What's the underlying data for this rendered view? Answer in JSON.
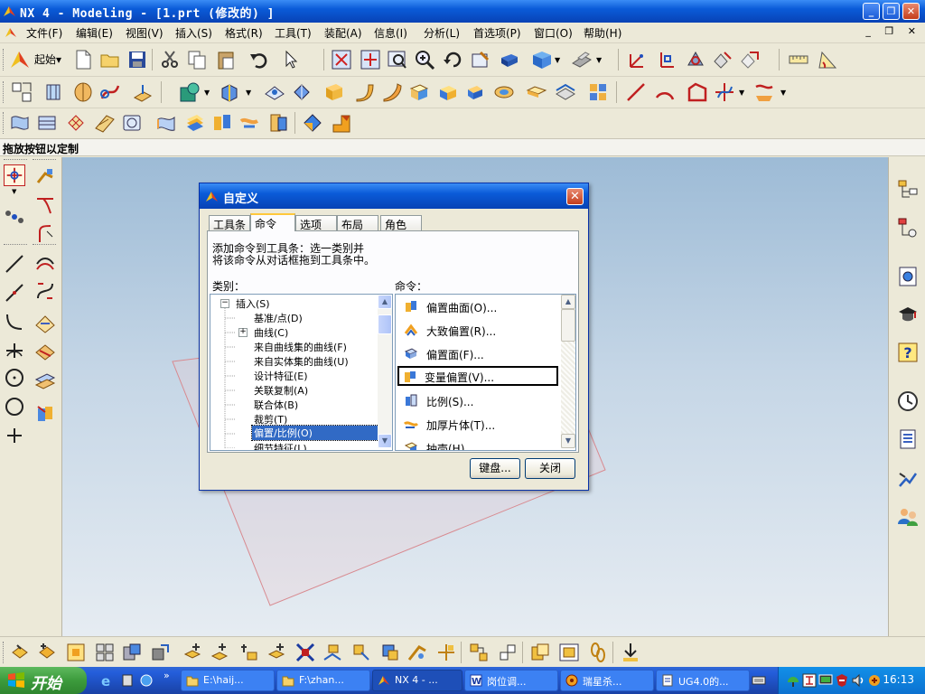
{
  "window": {
    "title": "NX 4 - Modeling - [1.prt (修改的) ]",
    "controls": [
      "_",
      "❐",
      "✕"
    ]
  },
  "menu": {
    "items": [
      "文件(F)",
      "编辑(E)",
      "视图(V)",
      "插入(S)",
      "格式(R)",
      "工具(T)",
      "装配(A)",
      "信息(I)",
      "分析(L)",
      "首选项(P)",
      "窗口(O)",
      "帮助(H)"
    ],
    "doc_controls": "_ ❐ ✕"
  },
  "toolbar": {
    "start_label": "起始▾"
  },
  "cue_line": "拖放按钮以定制",
  "colors": {
    "title_blue": "#0a5bd8",
    "selection": "#316ac5",
    "tab_highlight": "#ffc83c"
  },
  "dialog": {
    "title": "自定义",
    "close": "✕",
    "tabs": [
      {
        "label": "工具条",
        "active": false
      },
      {
        "label": "命令",
        "active": true
      },
      {
        "label": "选项",
        "active": false
      },
      {
        "label": "布局",
        "active": false
      },
      {
        "label": "角色",
        "active": false
      }
    ],
    "description_line1": "添加命令到工具条：选一类别并",
    "description_line2": "将该命令从对话框拖到工具条中。",
    "category_label": "类别：",
    "command_label": "命令：",
    "categories": [
      {
        "label": "插入(S)",
        "expander": "−",
        "level": 0,
        "selected": false
      },
      {
        "label": "基准/点(D)",
        "expander": "",
        "level": 1,
        "selected": false
      },
      {
        "label": "曲线(C)",
        "expander": "+",
        "level": 1,
        "selected": false
      },
      {
        "label": "来自曲线集的曲线(F)",
        "expander": "",
        "level": 1,
        "selected": false
      },
      {
        "label": "来自实体集的曲线(U)",
        "expander": "",
        "level": 1,
        "selected": false
      },
      {
        "label": "设计特征(E)",
        "expander": "",
        "level": 1,
        "selected": false
      },
      {
        "label": "关联复制(A)",
        "expander": "",
        "level": 1,
        "selected": false
      },
      {
        "label": "联合体(B)",
        "expander": "",
        "level": 1,
        "selected": false
      },
      {
        "label": "裁剪(T)",
        "expander": "",
        "level": 1,
        "selected": false
      },
      {
        "label": "偏置/比例(O)",
        "expander": "",
        "level": 1,
        "selected": true
      },
      {
        "label": "细节特征(L)",
        "expander": "",
        "level": 1,
        "selected": false
      }
    ],
    "commands": [
      {
        "label": "偏置曲面(O)...",
        "icon": "offset-surface-icon",
        "focused": false
      },
      {
        "label": "大致偏置(R)...",
        "icon": "rough-offset-icon",
        "focused": false
      },
      {
        "label": "偏置面(F)...",
        "icon": "offset-face-icon",
        "focused": false
      },
      {
        "label": "变量偏置(V)...",
        "icon": "variable-offset-icon",
        "focused": true
      },
      {
        "label": "比例(S)...",
        "icon": "scale-icon",
        "focused": false
      },
      {
        "label": "加厚片体(T)...",
        "icon": "thicken-sheet-icon",
        "focused": false
      },
      {
        "label": "抽壳(H)...",
        "icon": "shell-icon",
        "focused": false
      }
    ],
    "keyboard_button": "键盘...",
    "close_button": "关闭"
  },
  "taskbar": {
    "start_label": "开始",
    "tasks": [
      {
        "label": "E:\\haij...",
        "icon": "folder-icon",
        "active": false
      },
      {
        "label": "F:\\zhan...",
        "icon": "folder-icon",
        "active": false
      },
      {
        "label": "NX 4 - ...",
        "icon": "nx-icon",
        "active": true
      },
      {
        "label": "岗位调...",
        "icon": "word-icon",
        "active": false
      },
      {
        "label": "瑞星杀...",
        "icon": "rising-icon",
        "active": false
      },
      {
        "label": "UG4.0的...",
        "icon": "document-icon",
        "active": false
      }
    ],
    "clock": "16:13"
  }
}
